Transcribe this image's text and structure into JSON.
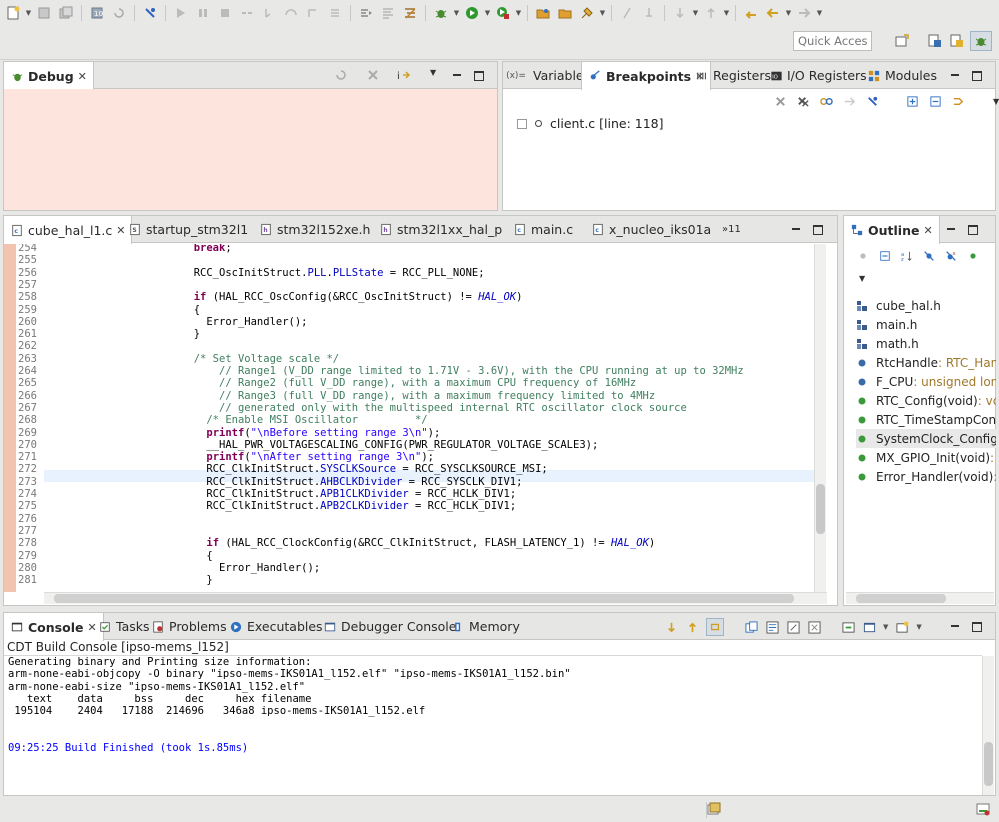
{
  "toolbar": {
    "quick_access_placeholder": "Quick Access"
  },
  "debug_panel": {
    "tab_label": "Debug"
  },
  "variables_panel": {
    "tabs": [
      "Variables",
      "Breakpoints",
      "Registers",
      "I/O Registers",
      "Modules"
    ],
    "breakpoint_entry": "client.c [line: 118]"
  },
  "editor": {
    "tabs": [
      "cube_hal_l1.c",
      "startup_stm32l1",
      "stm32l152xe.h",
      "stm32l1xx_hal_p",
      "main.c",
      "x_nucleo_iks01a",
      "»11"
    ],
    "lines": [
      {
        "n": "254",
        "text": "                        break;"
      },
      {
        "n": "255",
        "text": ""
      },
      {
        "n": "256",
        "text": "                        RCC_OscInitStruct.PLL.PLLState = RCC_PLL_NONE;"
      },
      {
        "n": "257",
        "text": ""
      },
      {
        "n": "258",
        "text": "                        if (HAL_RCC_OscConfig(&RCC_OscInitStruct) != HAL_OK)"
      },
      {
        "n": "259",
        "text": "                        {"
      },
      {
        "n": "260",
        "text": "                          Error_Handler();"
      },
      {
        "n": "261",
        "text": "                        }"
      },
      {
        "n": "262",
        "text": ""
      },
      {
        "n": "263",
        "text": "                        /* Set Voltage scale */"
      },
      {
        "n": "264",
        "text": "                            // Range1 (V_DD range limited to 1.71V - 3.6V), with the CPU running at up to 32MHz"
      },
      {
        "n": "265",
        "text": "                            // Range2 (full V_DD range), with a maximum CPU frequency of 16MHz"
      },
      {
        "n": "266",
        "text": "                            // Range3 (full V_DD range), with a maximum frequency limited to 4MHz"
      },
      {
        "n": "267",
        "text": "                            // generated only with the multispeed internal RTC oscillator clock source"
      },
      {
        "n": "268",
        "text": "                          /* Enable MSI Oscillator         */"
      },
      {
        "n": "269",
        "text": "                          printf(\"\\nBefore setting range 3\\n\");"
      },
      {
        "n": "270",
        "text": "                          __HAL_PWR_VOLTAGESCALING_CONFIG(PWR_REGULATOR_VOLTAGE_SCALE3);"
      },
      {
        "n": "271",
        "text": "                          printf(\"\\nAfter setting range 3\\n\");"
      },
      {
        "n": "272",
        "text": "                          RCC_ClkInitStruct.SYSCLKSource = RCC_SYSCLKSOURCE_MSI;"
      },
      {
        "n": "273",
        "text": "                          RCC_ClkInitStruct.AHBCLKDivider = RCC_SYSCLK_DIV1;"
      },
      {
        "n": "274",
        "text": "                          RCC_ClkInitStruct.APB1CLKDivider = RCC_HCLK_DIV1;"
      },
      {
        "n": "275",
        "text": "                          RCC_ClkInitStruct.APB2CLKDivider = RCC_HCLK_DIV1;"
      },
      {
        "n": "276",
        "text": ""
      },
      {
        "n": "277",
        "text": ""
      },
      {
        "n": "278",
        "text": "                          if (HAL_RCC_ClockConfig(&RCC_ClkInitStruct, FLASH_LATENCY_1) != HAL_OK)"
      },
      {
        "n": "279",
        "text": "                          {"
      },
      {
        "n": "280",
        "text": "                            Error_Handler();"
      },
      {
        "n": "281",
        "text": "                          }"
      }
    ]
  },
  "outline": {
    "tab_label": "Outline",
    "items": [
      {
        "name": "cube_hal.h",
        "type": ""
      },
      {
        "name": "main.h",
        "type": ""
      },
      {
        "name": "math.h",
        "type": ""
      },
      {
        "name": "RtcHandle",
        "type": " : RTC_Han"
      },
      {
        "name": "F_CPU",
        "type": " : unsigned lon"
      },
      {
        "name": "RTC_Config(void)",
        "type": " : vc"
      },
      {
        "name": "RTC_TimeStampConf",
        "type": ""
      },
      {
        "name": "SystemClock_Config(",
        "type": ""
      },
      {
        "name": "MX_GPIO_Init(void)",
        "type": " :"
      },
      {
        "name": "Error_Handler(void)",
        "type": " :"
      }
    ]
  },
  "console": {
    "tabs": [
      "Console",
      "Tasks",
      "Problems",
      "Executables",
      "Debugger Console",
      "Memory"
    ],
    "title": "CDT Build Console [ipso-mems_l152]",
    "lines": [
      "Generating binary and Printing size information:",
      "arm-none-eabi-objcopy -O binary \"ipso-mems-IKS01A1_l152.elf\" \"ipso-mems-IKS01A1_l152.bin\"",
      "arm-none-eabi-size \"ipso-mems-IKS01A1_l152.elf\"",
      "   text    data     bss     dec     hex filename",
      " 195104    2404   17188  214696   346a8 ipso-mems-IKS01A1_l152.elf",
      "",
      "",
      "09:25:25 Build Finished (took 1s.85ms)"
    ]
  }
}
